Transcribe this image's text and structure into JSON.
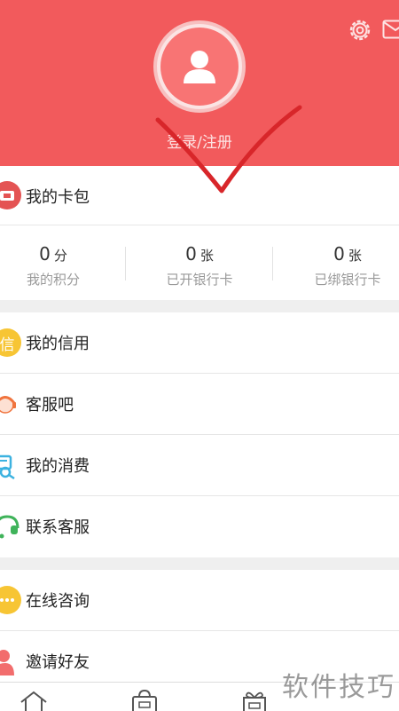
{
  "header": {
    "login_text": "登录/注册",
    "background_color": "#f25a5c"
  },
  "wallet": {
    "title": "我的卡包",
    "stats": [
      {
        "value": "0",
        "unit": "分",
        "label": "我的积分"
      },
      {
        "value": "0",
        "unit": "张",
        "label": "已开银行卡"
      },
      {
        "value": "0",
        "unit": "张",
        "label": "已绑银行卡"
      }
    ]
  },
  "menu_group_1": [
    {
      "label": "我的信用",
      "icon": "credit-icon"
    },
    {
      "label": "客服吧",
      "icon": "headset-avatar-icon"
    },
    {
      "label": "我的消费",
      "icon": "consumption-icon"
    },
    {
      "label": "联系客服",
      "icon": "headset-icon"
    }
  ],
  "menu_group_2": [
    {
      "label": "在线咨询",
      "icon": "chat-bubble-icon"
    },
    {
      "label": "邀请好友",
      "icon": "invite-friend-icon"
    }
  ],
  "credit_icon_text": "信",
  "watermark": "软件技巧",
  "bottom_nav": [
    "home-icon",
    "shop-bag-icon",
    "gift-icon"
  ]
}
